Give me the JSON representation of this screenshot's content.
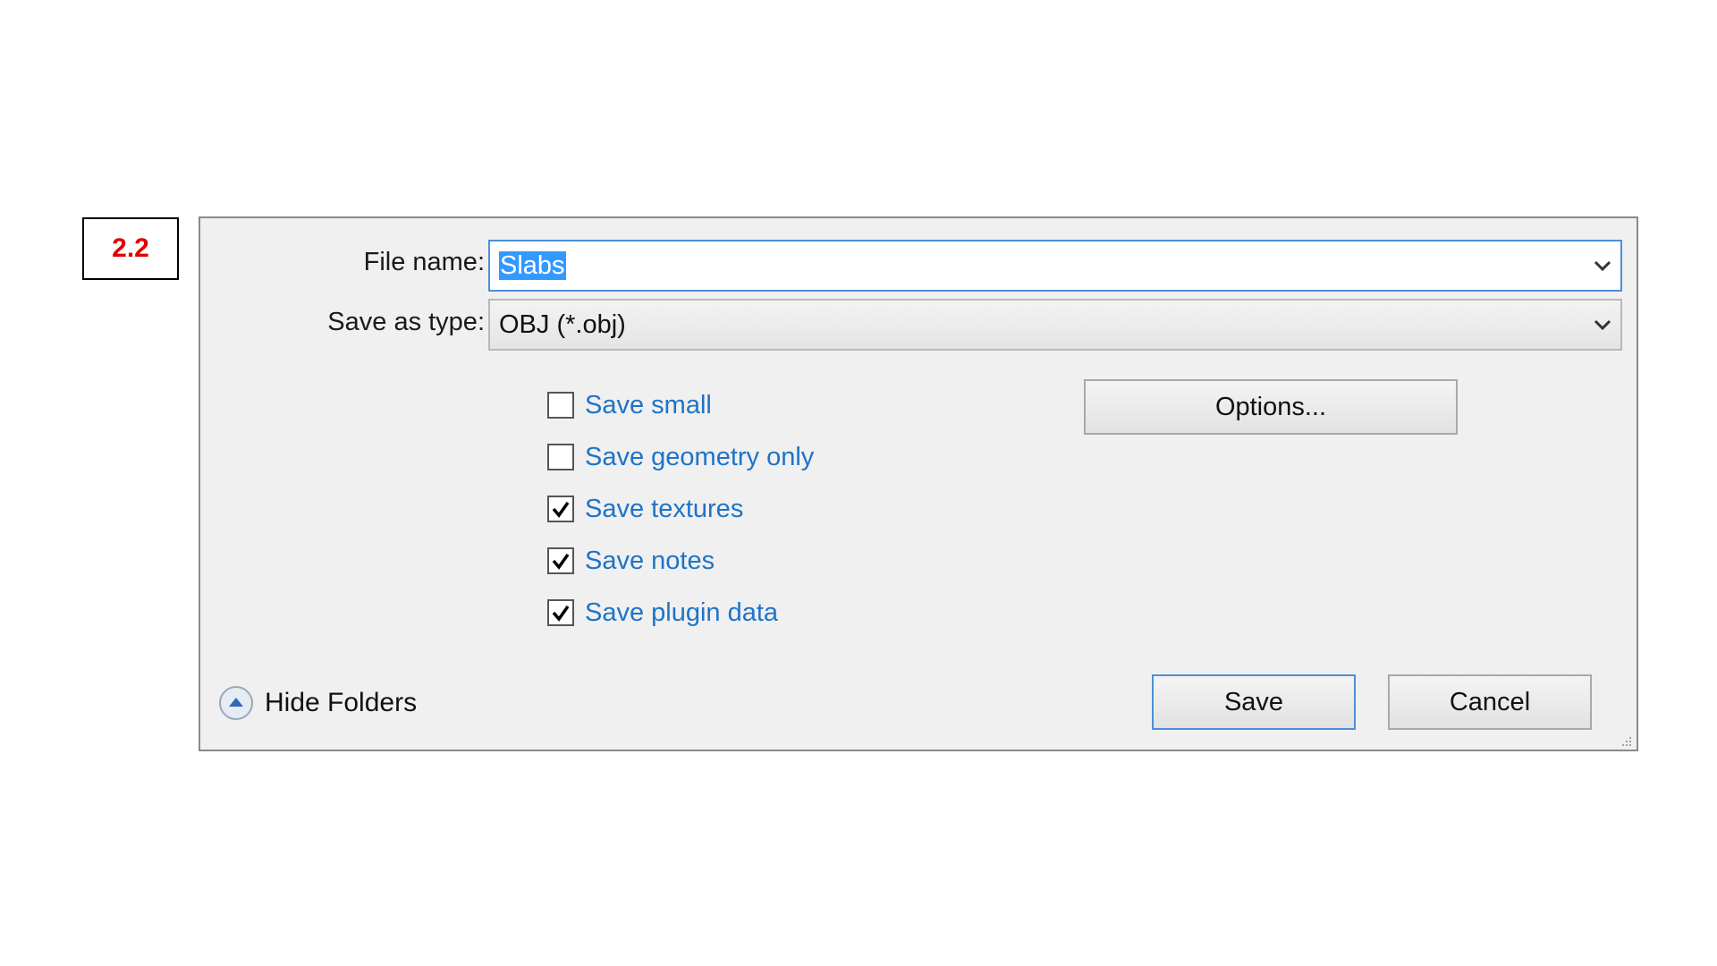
{
  "step_label": "2.2",
  "dialog": {
    "file_name_label": "File name:",
    "file_name_value": "Slabs",
    "save_as_type_label": "Save as type:",
    "save_as_type_value": "OBJ (*.obj)",
    "options_button": "Options...",
    "checkboxes": [
      {
        "label": "Save small",
        "checked": false
      },
      {
        "label": "Save geometry only",
        "checked": false
      },
      {
        "label": "Save textures",
        "checked": true
      },
      {
        "label": "Save notes",
        "checked": true
      },
      {
        "label": "Save plugin data",
        "checked": true
      }
    ],
    "hide_folders_label": "Hide Folders",
    "save_button": "Save",
    "cancel_button": "Cancel"
  },
  "colors": {
    "accent": "#4a90d9",
    "selection": "#3399ff",
    "checkbox_label": "#1e73c8",
    "step_label_text": "#e00000"
  },
  "icons": {
    "combo_arrow": "chevron-down-icon",
    "check_mark": "checkmark-icon",
    "hide_folders": "chevron-up-circle-icon",
    "resize": "resize-grip-icon"
  }
}
